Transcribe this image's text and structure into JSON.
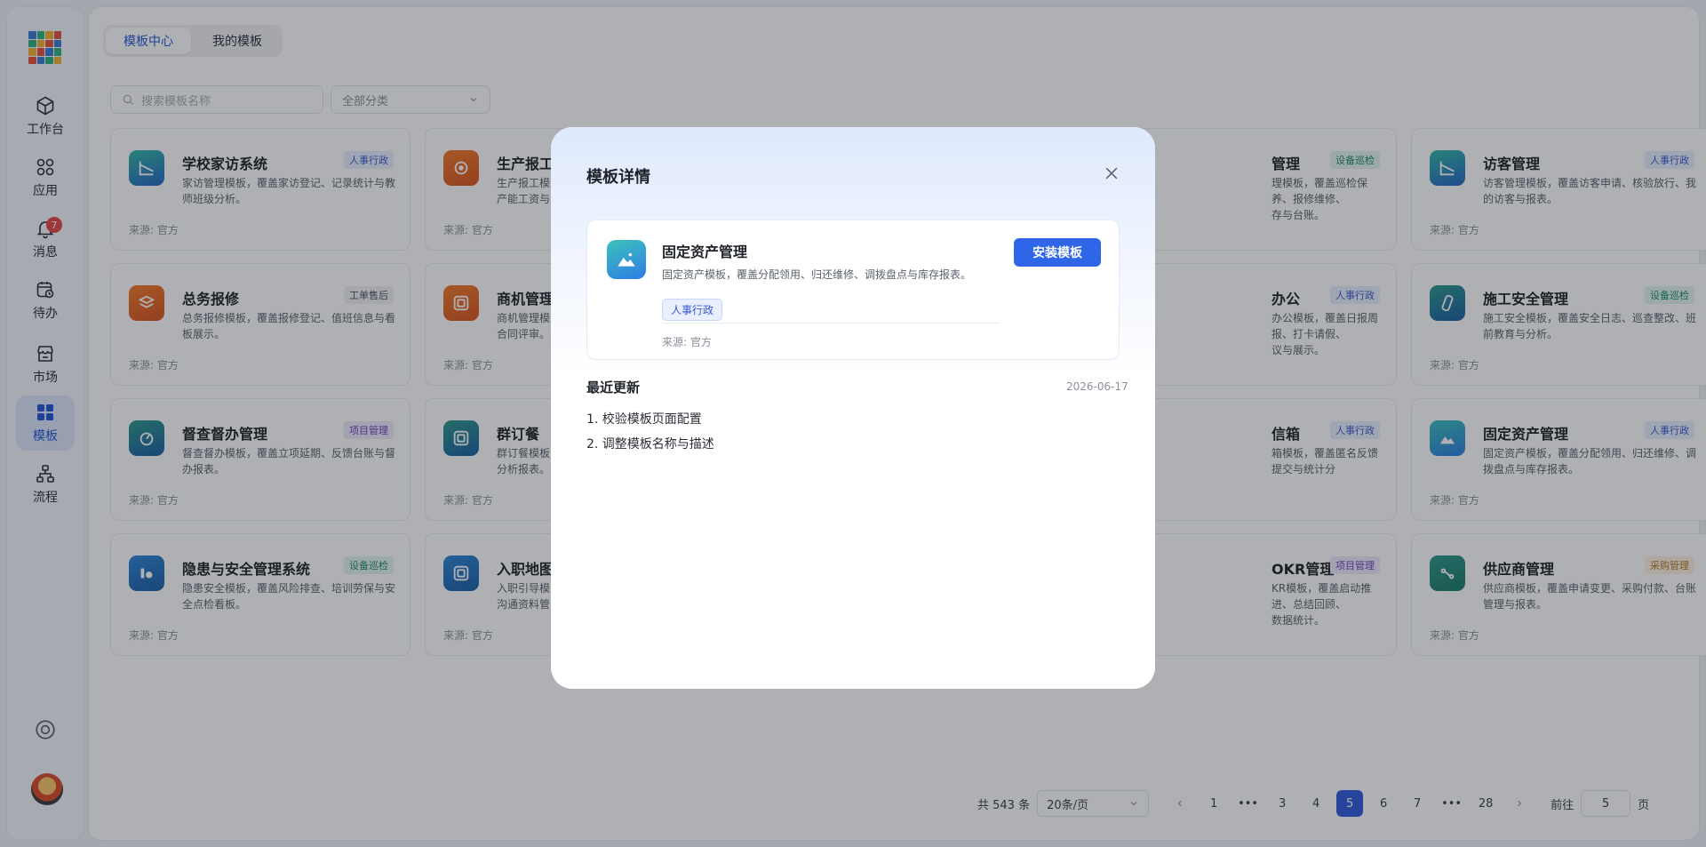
{
  "brand": {
    "accent": "#2f66e8",
    "active_nav": "#2457d6"
  },
  "nav": {
    "items": [
      {
        "label": "工作台",
        "icon": "cube-icon"
      },
      {
        "label": "应用",
        "icon": "grid-icon"
      },
      {
        "label": "消息",
        "icon": "bell-icon",
        "badge": "7"
      },
      {
        "label": "待办",
        "icon": "calendar-clock-icon"
      },
      {
        "label": "市场",
        "icon": "store-icon"
      },
      {
        "label": "模板",
        "icon": "template-icon",
        "active": true
      },
      {
        "label": "流程",
        "icon": "flow-icon"
      }
    ]
  },
  "tabs": {
    "center": "模板中心",
    "mine": "我的模板"
  },
  "filters": {
    "search_placeholder": "搜索模板名称",
    "category": "全部分类"
  },
  "cards": [
    {
      "title": "学校家访系统",
      "tag": "人事行政",
      "desc": "家访管理模板，覆盖家访登记、记录统计与教师班级分析。",
      "source": "来源: 官方"
    },
    {
      "title": "生产报工",
      "tag": "",
      "desc": "生产报工模",
      "desc2": "产能工资与",
      "source": "来源: 官方"
    },
    {
      "title": "管理",
      "tag": "设备巡检",
      "desc": "理模板，覆盖巡检保养、报修维修、",
      "desc2": "存与台账。",
      "source": ""
    },
    {
      "title": "访客管理",
      "tag": "人事行政",
      "desc": "访客管理模板，覆盖访客申请、核验放行、我的访客与报表。",
      "source": "来源: 官方"
    },
    {
      "title": "总务报修",
      "tag": "工单售后",
      "desc": "总务报修模板，覆盖报修登记、值班信息与看板展示。",
      "source": "来源: 官方"
    },
    {
      "title": "商机管理",
      "tag": "",
      "desc": "商机管理模",
      "desc2": "合同评审。",
      "source": "来源: 官方"
    },
    {
      "title": "办公",
      "tag": "人事行政",
      "desc": "办公模板，覆盖日报周报、打卡请假、",
      "desc2": "议与展示。",
      "source": ""
    },
    {
      "title": "施工安全管理",
      "tag": "设备巡检",
      "desc": "施工安全模板，覆盖安全日志、巡查整改、班前教育与分析。",
      "source": "来源: 官方"
    },
    {
      "title": "督查督办管理",
      "tag": "项目管理",
      "desc": "督查督办模板，覆盖立项延期、反馈台账与督办报表。",
      "source": "来源: 官方"
    },
    {
      "title": "群订餐",
      "tag": "",
      "desc": "群订餐模板",
      "desc2": "分析报表。",
      "source": "来源: 官方"
    },
    {
      "title": "信箱",
      "tag": "人事行政",
      "desc": "箱模板，覆盖匿名反馈提交与统计分",
      "desc2": "",
      "source": ""
    },
    {
      "title": "固定资产管理",
      "tag": "人事行政",
      "desc": "固定资产模板，覆盖分配领用、归还维修、调拨盘点与库存报表。",
      "source": "来源: 官方"
    },
    {
      "title": "隐患与安全管理系统",
      "tag": "设备巡检",
      "desc": "隐患安全模板，覆盖风险排查、培训劳保与安全点检看板。",
      "source": "来源: 官方"
    },
    {
      "title": "入职地图",
      "tag": "",
      "desc": "入职引导模",
      "desc2": "沟通资料管",
      "source": "来源: 官方"
    },
    {
      "title": "OKR管理",
      "tag": "项目管理",
      "desc": "KR模板，覆盖启动推进、总结回顾、",
      "desc2": "数据统计。",
      "source": ""
    },
    {
      "title": "供应商管理",
      "tag": "采购管理",
      "desc": "供应商模板，覆盖申请变更、采购付款、台账管理与报表。",
      "source": "来源: 官方"
    }
  ],
  "pager": {
    "total": "共 543 条",
    "page_size": "20条/页",
    "pages": [
      "1",
      "•••",
      "3",
      "4",
      "5",
      "6",
      "7",
      "•••",
      "28"
    ],
    "current": "5",
    "goto_label": "前往",
    "goto_value": "5",
    "page_unit": "页"
  },
  "modal": {
    "title": "模板详情",
    "template": {
      "name": "固定资产管理",
      "desc": "固定资产模板，覆盖分配领用、归还维修、调拨盘点与库存报表。",
      "install_label": "安装模板",
      "tag": "人事行政",
      "source": "来源: 官方"
    },
    "updates": {
      "title": "最近更新",
      "date": "2026-06-17",
      "items": [
        "1. 校验模板页面配置",
        "2. 调整模板名称与描述"
      ]
    }
  }
}
